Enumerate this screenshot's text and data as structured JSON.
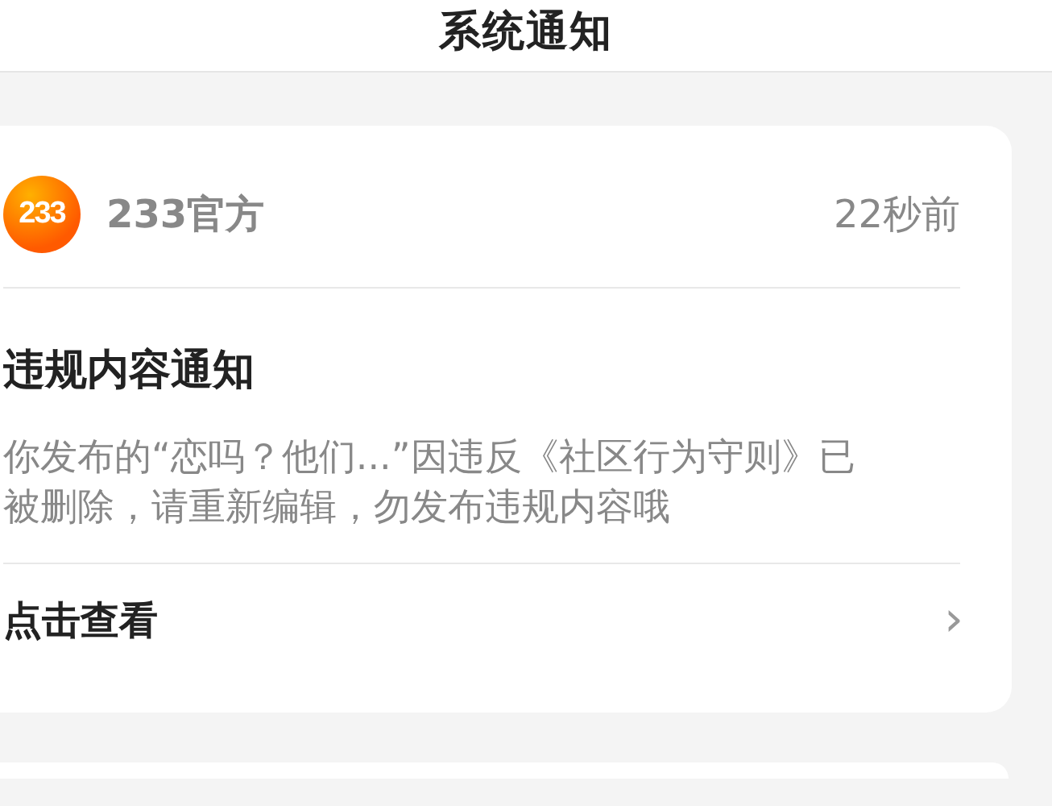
{
  "header": {
    "title": "系统通知"
  },
  "notifications": [
    {
      "logo": "233",
      "sender": "233官方",
      "time": "22秒前",
      "title": "违规内容通知",
      "body": "你发布的“恋吗？他们...”因违反《社区行为守则》已被删除，请重新编辑，勿发布违规内容哦",
      "action": "点击查看",
      "chevron": "›"
    }
  ]
}
